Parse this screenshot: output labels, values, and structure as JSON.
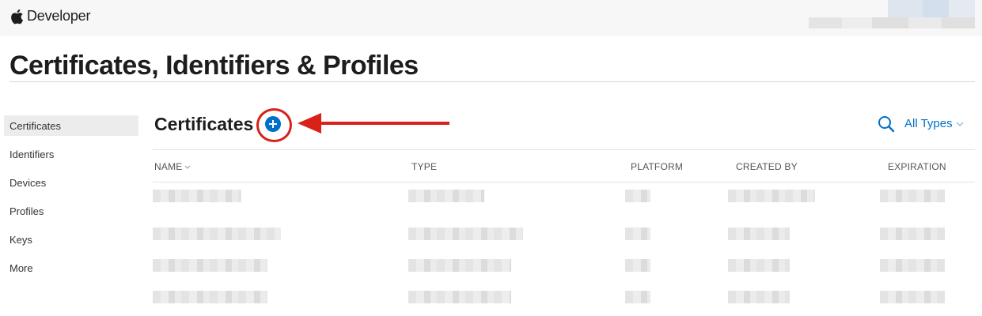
{
  "header": {
    "brand": "Developer"
  },
  "page": {
    "title": "Certificates, Identifiers & Profiles"
  },
  "sidebar": {
    "items": [
      {
        "label": "Certificates",
        "active": true
      },
      {
        "label": "Identifiers",
        "active": false
      },
      {
        "label": "Devices",
        "active": false
      },
      {
        "label": "Profiles",
        "active": false
      },
      {
        "label": "Keys",
        "active": false
      },
      {
        "label": "More",
        "active": false
      }
    ]
  },
  "section": {
    "title": "Certificates",
    "filter_label": "All Types"
  },
  "table": {
    "columns": [
      "NAME",
      "TYPE",
      "PLATFORM",
      "CREATED BY",
      "EXPIRATION"
    ]
  },
  "colors": {
    "accent": "#0070c9",
    "annotation": "#d9211a"
  },
  "icons": [
    "apple-logo-icon",
    "add-circle-icon",
    "search-icon",
    "chevron-down-icon"
  ]
}
